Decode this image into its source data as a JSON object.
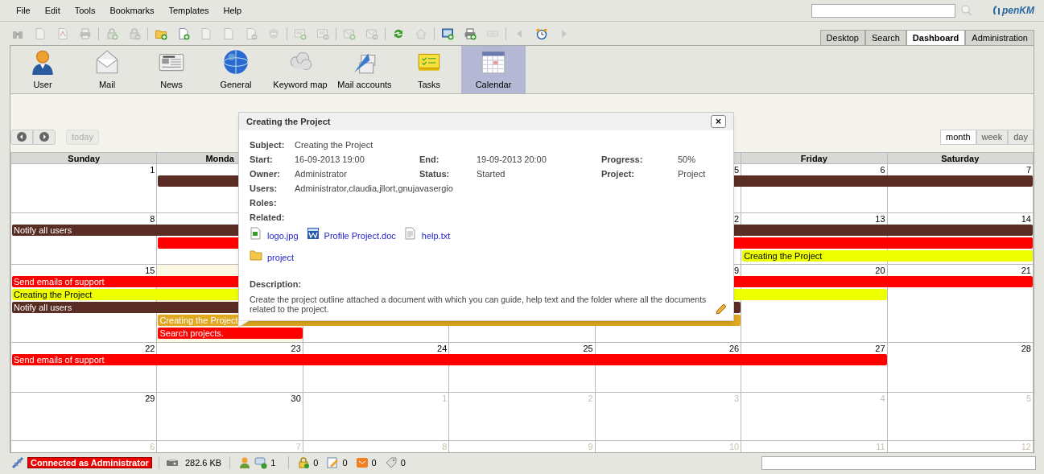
{
  "menu": [
    "File",
    "Edit",
    "Tools",
    "Bookmarks",
    "Templates",
    "Help"
  ],
  "logo": "penKM",
  "toolbar": [
    [
      {
        "kind": "binoculars",
        "disabled": true
      },
      {
        "kind": "document-download",
        "disabled": true
      },
      {
        "kind": "pdf-document",
        "disabled": true
      },
      {
        "kind": "printer",
        "disabled": true
      }
    ],
    [
      {
        "kind": "lock-add",
        "disabled": true
      },
      {
        "kind": "lock-remove",
        "disabled": true
      }
    ],
    [
      {
        "kind": "folder-add",
        "disabled": false
      },
      {
        "kind": "document-add",
        "disabled": false
      },
      {
        "kind": "document-edit",
        "disabled": true
      },
      {
        "kind": "document-check",
        "disabled": true
      },
      {
        "kind": "document-remove",
        "disabled": true
      },
      {
        "kind": "minus-circle",
        "disabled": true
      }
    ],
    [
      {
        "kind": "note-add",
        "disabled": true
      },
      {
        "kind": "note-remove",
        "disabled": true
      }
    ],
    [
      {
        "kind": "mail-add",
        "disabled": true
      },
      {
        "kind": "mail-remove",
        "disabled": true
      }
    ],
    [
      {
        "kind": "refresh",
        "disabled": false
      },
      {
        "kind": "home",
        "disabled": true
      }
    ],
    [
      {
        "kind": "screen-add",
        "disabled": false
      },
      {
        "kind": "printer-add",
        "disabled": false
      },
      {
        "kind": "scanner",
        "disabled": true
      }
    ],
    [
      {
        "kind": "arrow-left",
        "disabled": true
      },
      {
        "kind": "clock",
        "disabled": false
      },
      {
        "kind": "arrow-right",
        "disabled": true
      }
    ]
  ],
  "main_tabs": [
    {
      "label": "Desktop",
      "selected": false
    },
    {
      "label": "Search",
      "selected": false
    },
    {
      "label": "Dashboard",
      "selected": true
    },
    {
      "label": "Administration",
      "selected": false
    }
  ],
  "dashboard_tabs": [
    {
      "kind": "user",
      "label": "User",
      "selected": false
    },
    {
      "kind": "mail",
      "label": "Mail",
      "selected": false
    },
    {
      "kind": "news",
      "label": "News",
      "selected": false
    },
    {
      "kind": "globe",
      "label": "General",
      "selected": false
    },
    {
      "kind": "clouds",
      "label": "Keyword map",
      "selected": false
    },
    {
      "kind": "mail-accounts",
      "label": "Mail accounts",
      "selected": false
    },
    {
      "kind": "tasks",
      "label": "Tasks",
      "selected": false
    },
    {
      "kind": "calendar",
      "label": "Calendar",
      "selected": true
    }
  ],
  "calendar": {
    "today_button": {
      "label": "today",
      "disabled": true
    },
    "views": [
      {
        "label": "month",
        "selected": true
      },
      {
        "label": "week",
        "selected": false
      },
      {
        "label": "day",
        "selected": false
      }
    ],
    "weekdays": [
      "Sunday",
      "Monda",
      "Friday",
      "Saturday"
    ],
    "weeks": [
      {
        "days": [
          {
            "day": "1",
            "in_month": true,
            "today": false
          },
          {
            "day": "5",
            "in_month": true,
            "today": false
          },
          {
            "day": "6",
            "in_month": true,
            "today": false
          },
          {
            "day": "7",
            "in_month": true,
            "today": false
          }
        ],
        "events": [
          {
            "color": "#5a2d24"
          }
        ]
      },
      {
        "days": [
          {
            "day": "8",
            "in_month": true,
            "today": false
          },
          {
            "day": "2",
            "in_month": true,
            "today": false
          },
          {
            "day": "13",
            "in_month": true,
            "today": false
          },
          {
            "day": "14",
            "in_month": true,
            "today": false
          }
        ],
        "events": [
          {
            "title": "Notify all users",
            "color": "#5a2d24"
          },
          {
            "color": "#ff0000"
          },
          {
            "title": "Creating the Project",
            "color": "#eeff00"
          }
        ]
      },
      {
        "days": [
          {
            "day": "15",
            "in_month": true,
            "today": false
          },
          {
            "today": true
          },
          {
            "day": "9",
            "in_month": true,
            "today": false
          },
          {
            "day": "20",
            "in_month": true,
            "today": false
          },
          {
            "day": "21",
            "in_month": true,
            "today": false
          }
        ],
        "events": [
          {
            "title": "Send emails of support",
            "color": "#ff0000"
          },
          {
            "title": "Creating the Project",
            "color": "#eeff00"
          },
          {
            "title": "Notify all users",
            "color": "#5a2d24"
          },
          {
            "title": "Creating the Project",
            "color": "#e0a820"
          },
          {
            "title": "Search projects.",
            "color": "#ff0000"
          }
        ]
      },
      {
        "days": [
          {
            "day": "22",
            "in_month": true,
            "today": false
          },
          {
            "day": "23",
            "in_month": true,
            "today": false
          },
          {
            "day": "24",
            "in_month": true,
            "today": false
          },
          {
            "day": "25",
            "in_month": true,
            "today": false
          },
          {
            "day": "26",
            "in_month": true,
            "today": false
          },
          {
            "day": "27",
            "in_month": true,
            "today": false
          },
          {
            "day": "28",
            "in_month": true,
            "today": false
          }
        ],
        "events": [
          {
            "title": "Send emails of support",
            "color": "#ff0000"
          }
        ]
      },
      {
        "days": [
          {
            "day": "29",
            "in_month": true,
            "today": false
          },
          {
            "day": "30",
            "in_month": true,
            "today": false
          },
          {
            "day": "1",
            "in_month": false,
            "today": false
          },
          {
            "day": "2",
            "in_month": false,
            "today": false
          },
          {
            "day": "3",
            "in_month": false,
            "today": false
          },
          {
            "day": "4",
            "in_month": false,
            "today": false
          },
          {
            "day": "5",
            "in_month": false,
            "today": false
          }
        ]
      },
      {
        "days": [
          {
            "day": "6",
            "in_month": false,
            "today": false
          },
          {
            "day": "7",
            "in_month": false,
            "today": false
          },
          {
            "day": "8",
            "in_month": false,
            "today": false
          },
          {
            "day": "9",
            "in_month": false,
            "today": false
          },
          {
            "day": "10",
            "in_month": false,
            "today": false
          },
          {
            "day": "11",
            "in_month": false,
            "today": false
          },
          {
            "day": "12",
            "in_month": false,
            "today": false
          }
        ]
      }
    ]
  },
  "popup": {
    "title": "Creating the Project",
    "close": "×",
    "rows": [
      [
        {
          "label": "Subject:",
          "value": "Creating the Project"
        }
      ],
      [
        {
          "label": "Start:",
          "value": "16-09-2013 19:00"
        },
        {
          "label": "End:",
          "value": "19-09-2013 20:00"
        },
        {
          "label": "Progress:",
          "value": "50%"
        }
      ],
      [
        {
          "label": "Owner:",
          "value": "Administrator"
        },
        {
          "label": "Status:",
          "value": "Started"
        },
        {
          "label": "Project:",
          "value": "Project"
        }
      ],
      [
        {
          "label": "Users:",
          "value": "Administrator,claudia,jllort,gnujavasergio"
        }
      ],
      [
        {
          "label": "Roles:"
        }
      ],
      [
        {
          "label": "Related:"
        }
      ]
    ],
    "related": [
      [
        {
          "kind": "image",
          "name": "logo.jpg"
        },
        {
          "kind": "word",
          "name": "Profile Project.doc"
        },
        {
          "kind": "text",
          "name": "help.txt"
        }
      ],
      [
        {
          "kind": "folder",
          "name": "project"
        }
      ]
    ],
    "description_label": "Description:",
    "description": "Create the project outline attached a document with which you can guide, help text and the folder where all the documents related to the project."
  },
  "status_bar": {
    "connection": "Connected as Administrator",
    "size": "282.6 KB",
    "counters": [
      [
        {
          "kind": "user"
        },
        {
          "kind": "chat",
          "count": "1"
        }
      ],
      [
        {
          "kind": "lock",
          "count": "0"
        },
        {
          "kind": "edit",
          "count": "0"
        },
        {
          "kind": "mail",
          "count": "0"
        },
        {
          "kind": "tag",
          "count": "0"
        }
      ]
    ]
  }
}
